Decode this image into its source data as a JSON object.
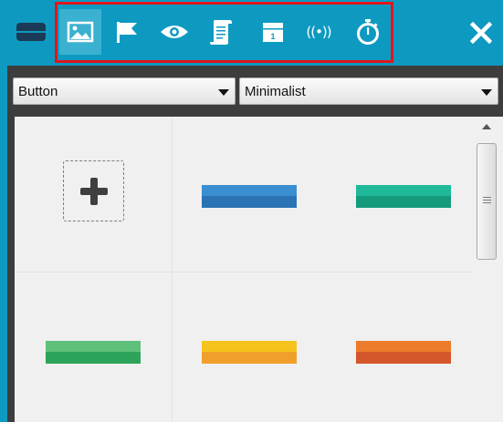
{
  "toolbar": {
    "background": "#0e9ac0",
    "highlight_color": "#e0161b",
    "icons": [
      "panel-icon",
      "image-icon",
      "flag-icon",
      "eye-icon",
      "scroll-document-icon",
      "calendar-icon",
      "broadcast-icon",
      "stopwatch-icon",
      "close-icon"
    ],
    "calendar_day": "1",
    "broadcast_text": "((•))"
  },
  "filters": {
    "type_value": "Button",
    "style_value": "Minimalist"
  },
  "tiles": [
    {
      "name": "add-new-tile",
      "icon": "plus-icon"
    },
    {
      "name": "blue-button-sample",
      "top": "#3b8fd0",
      "bottom": "#2a73b4"
    },
    {
      "name": "teal-button-sample",
      "top": "#1fb99a",
      "bottom": "#159b7c"
    },
    {
      "name": "green-button-sample",
      "top": "#5fc07a",
      "bottom": "#2ea45a"
    },
    {
      "name": "yellow-button-sample",
      "top": "#f5c31c",
      "bottom": "#f0a02a"
    },
    {
      "name": "orange-button-sample",
      "top": "#ec7b2b",
      "bottom": "#d4572b"
    }
  ]
}
